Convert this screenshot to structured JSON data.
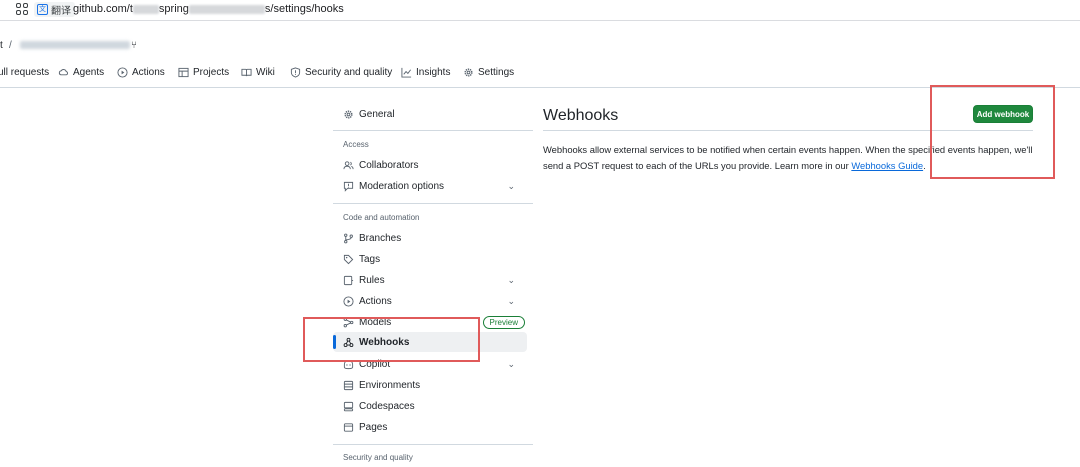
{
  "browser": {
    "translate_label": "翻译",
    "url_prefix": "github.com/t",
    "url_mid": "spring",
    "url_suffix": "s/settings/hooks"
  },
  "repo": {
    "owner_fragment": "t",
    "separator": "/",
    "fork_glyph": "⑂"
  },
  "tabs": [
    {
      "label": "ull requests",
      "icon": "pull-request-icon"
    },
    {
      "label": "Agents",
      "icon": "agents-icon"
    },
    {
      "label": "Actions",
      "icon": "play-icon"
    },
    {
      "label": "Projects",
      "icon": "table-icon"
    },
    {
      "label": "Wiki",
      "icon": "book-icon"
    },
    {
      "label": "Security and quality",
      "icon": "shield-icon"
    },
    {
      "label": "Insights",
      "icon": "graph-icon"
    },
    {
      "label": "Settings",
      "icon": "gear-icon"
    }
  ],
  "sidebar": {
    "general": "General",
    "section_access": "Access",
    "collaborators": "Collaborators",
    "moderation": "Moderation options",
    "section_code": "Code and automation",
    "branches": "Branches",
    "tags": "Tags",
    "rules": "Rules",
    "actions": "Actions",
    "models": "Models",
    "preview_badge": "Preview",
    "webhooks": "Webhooks",
    "copilot": "Copilot",
    "environments": "Environments",
    "codespaces": "Codespaces",
    "pages": "Pages",
    "section_security": "Security and quality"
  },
  "main": {
    "title": "Webhooks",
    "add_button": "Add webhook",
    "desc_text": "Webhooks allow external services to be notified when certain events happen. When the specified events happen, we'll send a POST request to each of the URLs you provide. Learn more in our ",
    "desc_link": "Webhooks Guide",
    "desc_end": "."
  },
  "colors": {
    "accent": "#0969da",
    "primary_button": "#1f883d",
    "highlight_box": "#e05a5a"
  }
}
